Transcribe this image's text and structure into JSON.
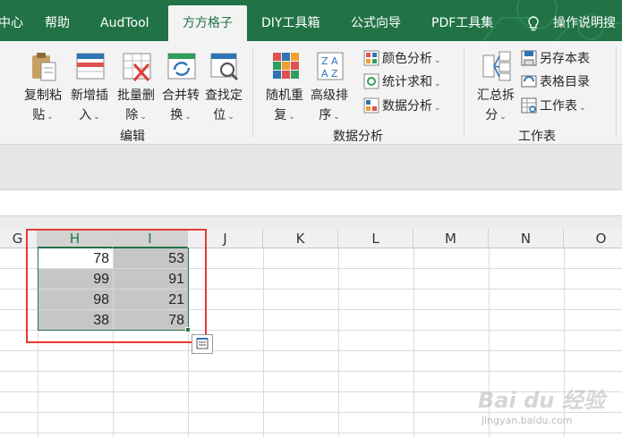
{
  "tabs": [
    {
      "label": "中心",
      "active": false
    },
    {
      "label": "帮助",
      "active": false
    },
    {
      "label": "AudTool",
      "active": false
    },
    {
      "label": "方方格子",
      "active": true
    },
    {
      "label": "DIY工具箱",
      "active": false
    },
    {
      "label": "公式向导",
      "active": false
    },
    {
      "label": "PDF工具集",
      "active": false
    }
  ],
  "tell_me": "操作说明搜",
  "ribbon": {
    "edit_group": {
      "label": "编辑",
      "buttons": [
        {
          "line1": "复制粘",
          "line2": "贴",
          "icon": "paste-icon"
        },
        {
          "line1": "新增插",
          "line2": "入",
          "icon": "insert-icon"
        },
        {
          "line1": "批量删",
          "line2": "除",
          "icon": "delete-icon"
        },
        {
          "line1": "合并转",
          "line2": "换",
          "icon": "merge-convert-icon"
        },
        {
          "line1": "查找定",
          "line2": "位",
          "icon": "find-locate-icon"
        }
      ]
    },
    "analysis_group": {
      "label": "数据分析",
      "buttons": [
        {
          "line1": "随机重",
          "line2": "复",
          "icon": "random-repeat-icon"
        },
        {
          "line1": "高级排",
          "line2": "序",
          "icon": "advanced-sort-icon"
        }
      ],
      "small": [
        {
          "label": "颜色分析",
          "icon": "color-analysis-icon"
        },
        {
          "label": "统计求和",
          "icon": "stat-sum-icon"
        },
        {
          "label": "数据分析",
          "icon": "data-analysis-icon"
        }
      ]
    },
    "sheet_group": {
      "label": "工作表",
      "buttons": [
        {
          "line1": "汇总拆",
          "line2": "分",
          "icon": "summary-split-icon"
        }
      ],
      "small": [
        {
          "label": "另存本表",
          "icon": "save-sheet-icon"
        },
        {
          "label": "表格目录",
          "icon": "sheet-directory-icon"
        },
        {
          "label": "工作表",
          "icon": "worksheet-icon"
        }
      ]
    }
  },
  "sheet": {
    "columns": [
      "G",
      "H",
      "I",
      "J",
      "K",
      "L",
      "M",
      "N",
      "O"
    ],
    "selected_columns": [
      "H",
      "I"
    ],
    "rows": [
      [
        "78",
        "53"
      ],
      [
        "99",
        "91"
      ],
      [
        "98",
        "21"
      ],
      [
        "38",
        "78"
      ]
    ]
  },
  "watermark": {
    "main": "Bai du 经验",
    "sub": "jingyan.baidu.com"
  },
  "colors": {
    "excel_green": "#217346",
    "highlight_red": "#e53935",
    "selected_gray": "#c6c6c6"
  }
}
